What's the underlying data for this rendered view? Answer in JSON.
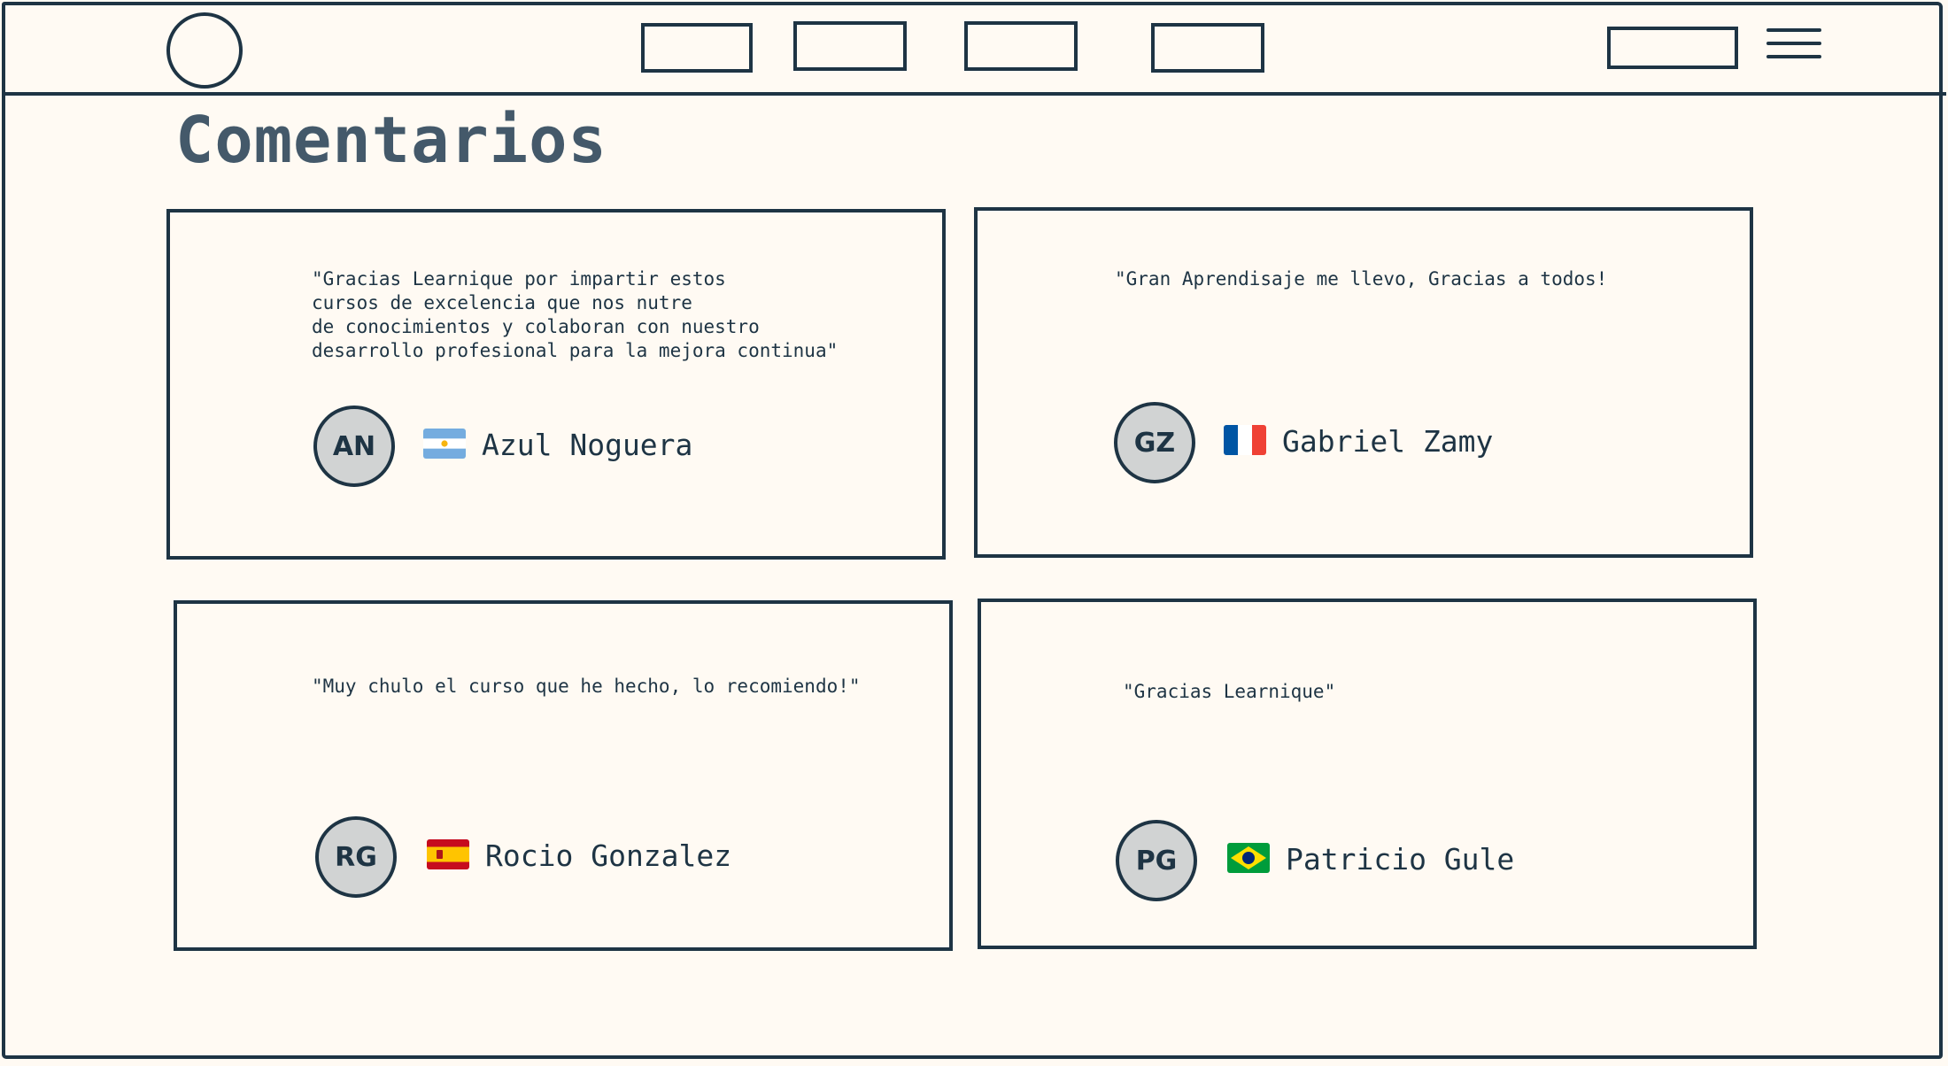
{
  "page": {
    "title": "Comentarios"
  },
  "navbar": {
    "logo": "logo-placeholder",
    "links": [
      "",
      "",
      "",
      ""
    ],
    "action": "",
    "menu_icon": "hamburger-menu-icon"
  },
  "comments": [
    {
      "quote": "\"Gracias Learnique por impartir estos\ncursos de excelencia que nos nutre\nde conocimientos y colaboran con nuestro\ndesarrollo profesional para la mejora continua\"",
      "initials": "AN",
      "name": "Azul Noguera",
      "flag": "argentina-flag-icon"
    },
    {
      "quote": "\"Gran Aprendisaje me llevo, Gracias a todos!",
      "initials": "GZ",
      "name": "Gabriel Zamy",
      "flag": "france-flag-icon"
    },
    {
      "quote": "\"Muy chulo el curso que he hecho, lo recomiendo!\"",
      "initials": "RG",
      "name": "Rocio Gonzalez",
      "flag": "spain-flag-icon"
    },
    {
      "quote": "\"Gracias Learnique\"",
      "initials": "PG",
      "name": "Patricio Gule",
      "flag": "brazil-flag-icon"
    }
  ],
  "colors": {
    "background": "#fffaf3",
    "ink": "#1e3444",
    "title": "#44596a",
    "avatar_fill": "#d1d3d3"
  }
}
